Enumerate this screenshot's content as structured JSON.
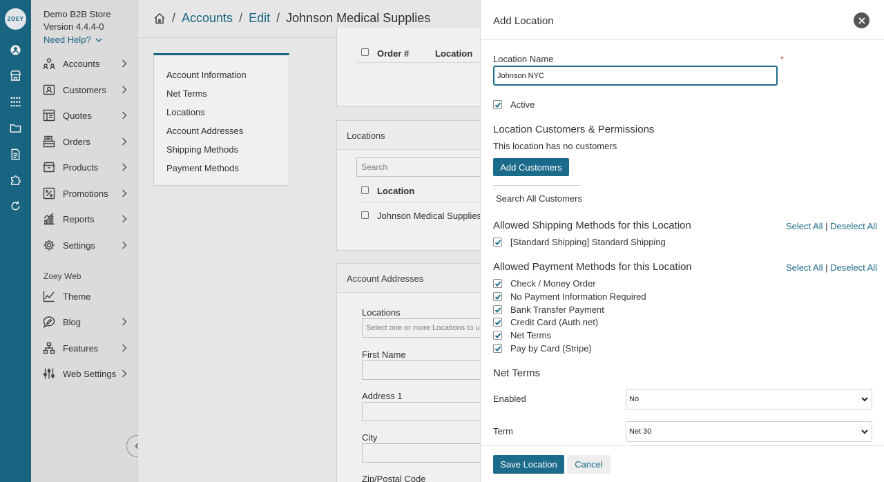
{
  "rail": {
    "logo": "ZOEY",
    "icons": [
      "account-icon",
      "store-icon",
      "apps-grid-icon",
      "folder-icon",
      "document-icon",
      "puzzle-icon",
      "refresh-icon"
    ]
  },
  "nav": {
    "store_name": "Demo B2B Store",
    "version": "Version 4.4.4-0",
    "help": "Need Help?",
    "items": [
      {
        "label": "Accounts",
        "icon": "accounts-icon"
      },
      {
        "label": "Customers",
        "icon": "customers-icon"
      },
      {
        "label": "Quotes",
        "icon": "quotes-icon"
      },
      {
        "label": "Orders",
        "icon": "orders-icon"
      },
      {
        "label": "Products",
        "icon": "products-icon"
      },
      {
        "label": "Promotions",
        "icon": "promotions-icon"
      },
      {
        "label": "Reports",
        "icon": "reports-icon"
      },
      {
        "label": "Settings",
        "icon": "settings-icon"
      }
    ],
    "web_section": "Zoey Web",
    "web_items": [
      {
        "label": "Theme",
        "icon": "theme-icon"
      },
      {
        "label": "Blog",
        "icon": "blog-icon"
      },
      {
        "label": "Features",
        "icon": "features-icon"
      },
      {
        "label": "Web Settings",
        "icon": "web-settings-icon"
      }
    ]
  },
  "breadcrumb": {
    "accounts": "Accounts",
    "edit": "Edit",
    "current": "Johnson Medical Supplies",
    "sep": "/"
  },
  "tabs": [
    "Account Information",
    "Net Terms",
    "Locations",
    "Account Addresses",
    "Shipping Methods",
    "Payment Methods"
  ],
  "orders_table": {
    "col_order": "Order #",
    "col_location": "Location"
  },
  "locations_card": {
    "title": "Locations",
    "search_placeholder": "Search",
    "col_location": "Location",
    "rows": [
      "Johnson Medical Supplies"
    ]
  },
  "addresses_card": {
    "title": "Account Addresses",
    "locations_label": "Locations",
    "locations_placeholder": "Select one or more Locations to use",
    "first_name": "First Name",
    "address1": "Address 1",
    "city": "City",
    "zip": "Zip/Postal Code"
  },
  "panel": {
    "title": "Add Location",
    "location_name_label": "Location Name",
    "required_mark": "*",
    "location_name_value": "Johnson NYC",
    "active_label": "Active",
    "customers_title": "Location Customers & Permissions",
    "no_customers": "This location has no customers",
    "add_customers": "Add Customers",
    "search_all": "Search All Customers",
    "shipping_title": "Allowed Shipping Methods for this Location",
    "shipping_methods": [
      "[Standard Shipping] Standard Shipping"
    ],
    "payment_title": "Allowed Payment Methods for this Location",
    "payment_methods": [
      "Check / Money Order",
      "No Payment Information Required",
      "Bank Transfer Payment",
      "Credit Card (Auth.net)",
      "Net Terms",
      "Pay by Card (Stripe)"
    ],
    "select_all": "Select All",
    "deselect_all": "Deselect All",
    "divider": "|",
    "net_terms_title": "Net Terms",
    "enabled_label": "Enabled",
    "enabled_value": "No",
    "term_label": "Term",
    "term_value": "Net 30",
    "save": "Save Location",
    "cancel": "Cancel"
  },
  "colors": {
    "primary": "#1b6b8a",
    "rail": "#1b6b8a",
    "required": "#d9362c"
  }
}
